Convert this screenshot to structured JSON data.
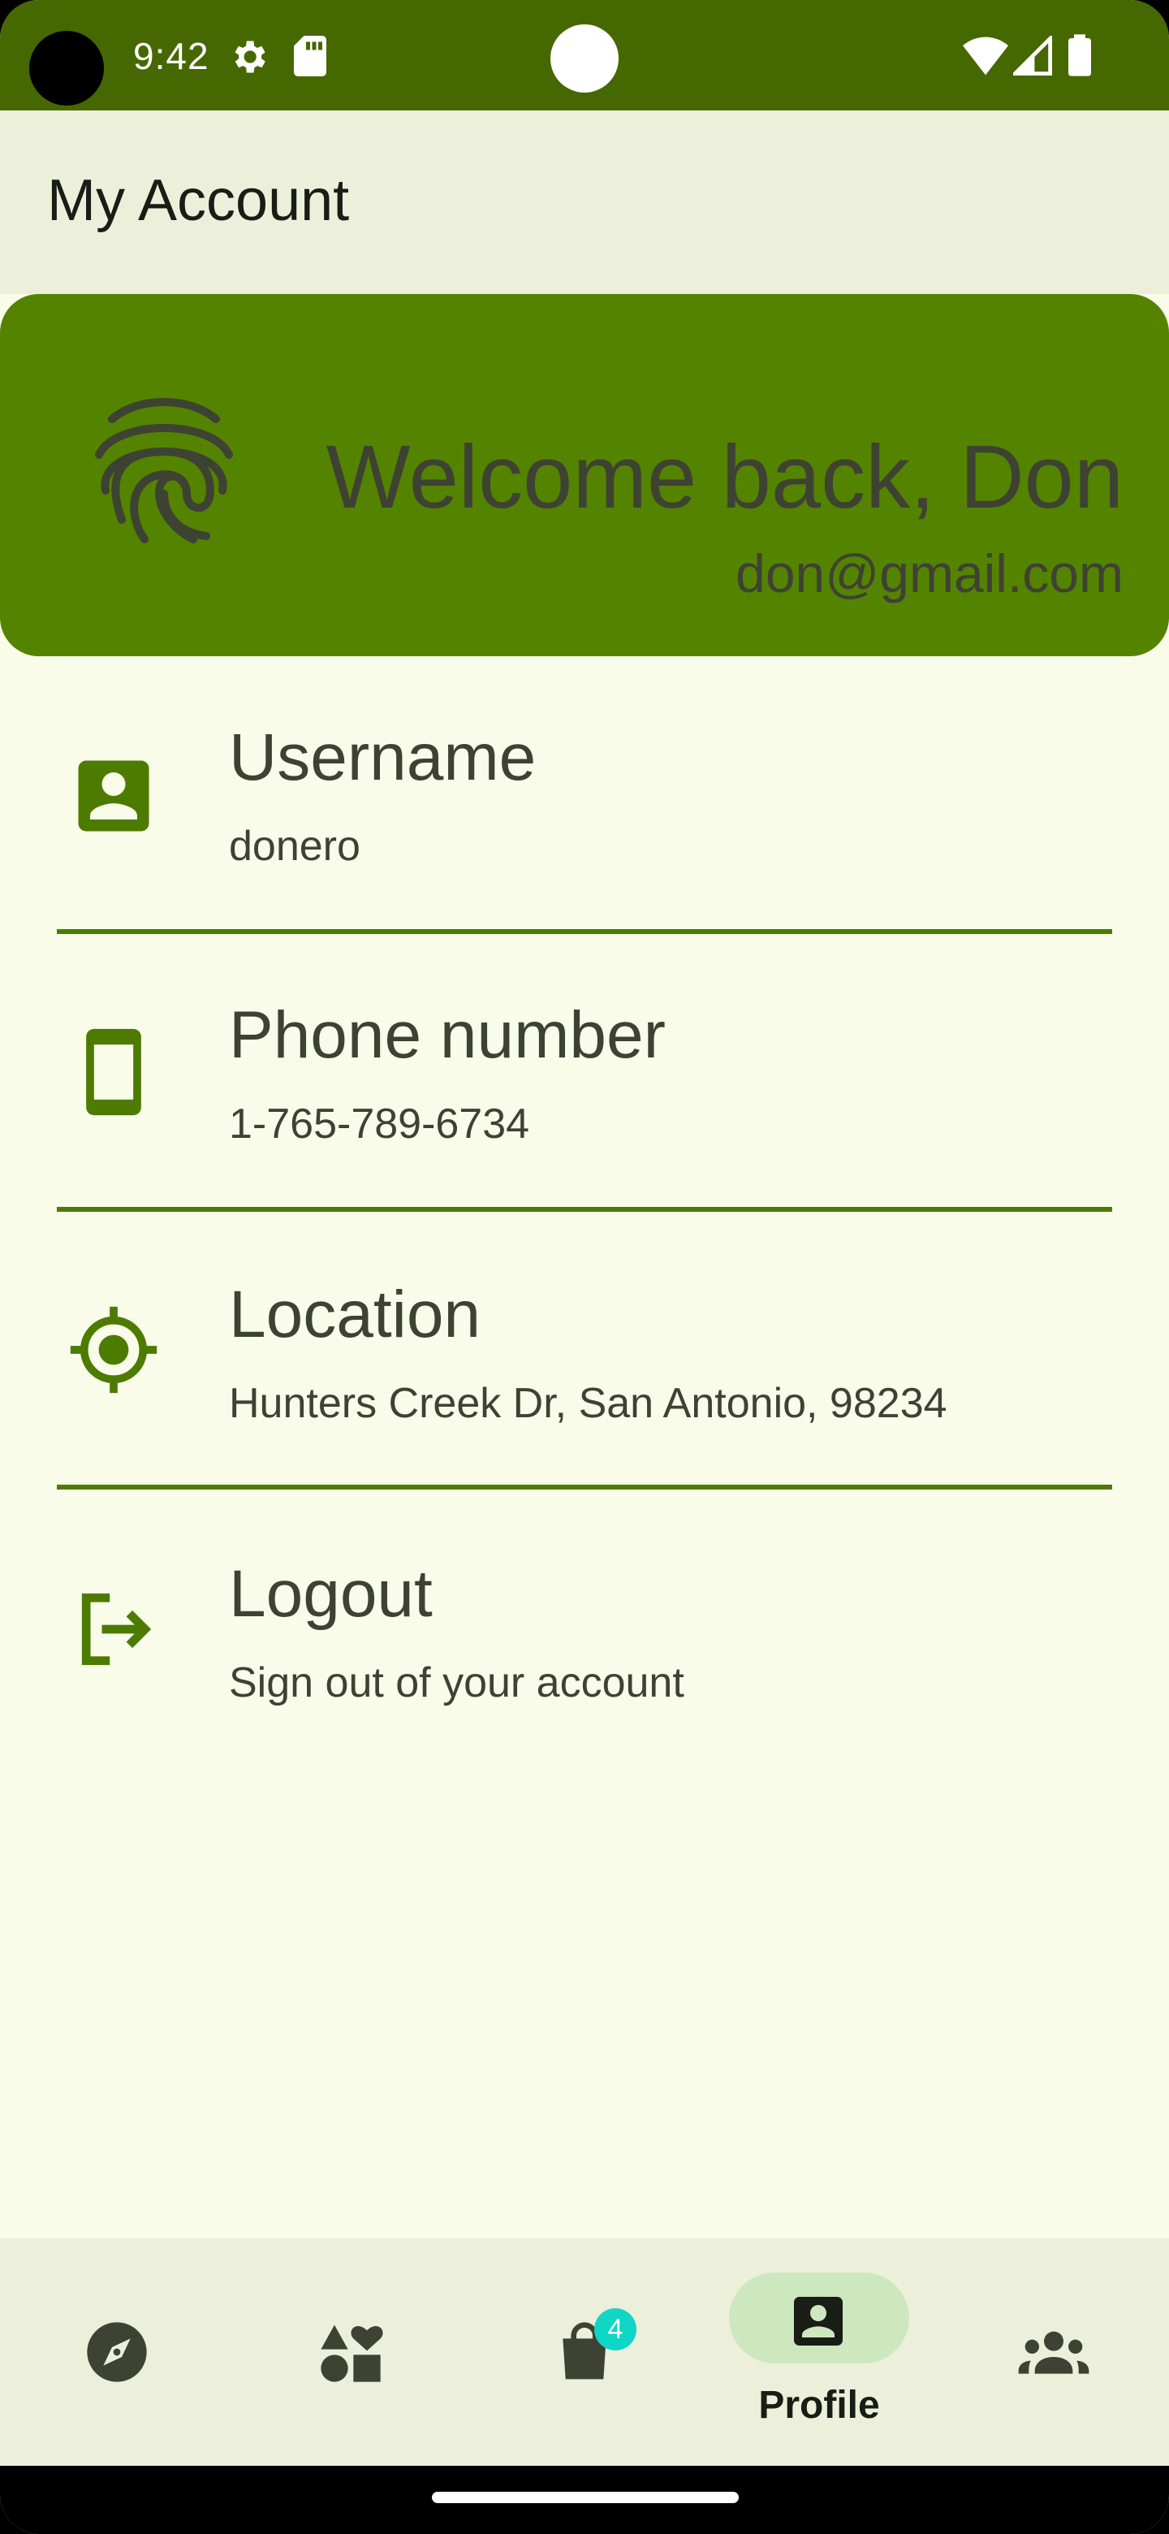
{
  "status_bar": {
    "time": "9:42",
    "icons": [
      "gear-icon",
      "sd-card-icon",
      "wifi-icon",
      "signal-icon",
      "battery-icon"
    ]
  },
  "app_bar": {
    "title": "My Account"
  },
  "header": {
    "welcome": "Welcome back, Don",
    "email": "don@gmail.com",
    "icon": "fingerprint-icon"
  },
  "items": [
    {
      "title": "Username",
      "subtitle": "donero",
      "icon": "account-box-icon"
    },
    {
      "title": "Phone number",
      "subtitle": "1-765-789-6734",
      "icon": "phone-icon"
    },
    {
      "title": "Location",
      "subtitle": "Hunters Creek Dr, San Antonio, 98234",
      "icon": "location-target-icon"
    },
    {
      "title": "Logout",
      "subtitle": "Sign out of your account",
      "icon": "logout-icon"
    }
  ],
  "bottom_nav": {
    "items": [
      {
        "icon": "explore-icon",
        "label": ""
      },
      {
        "icon": "category-icon",
        "label": ""
      },
      {
        "icon": "shopping-bag-icon",
        "label": "",
        "badge": "4"
      },
      {
        "icon": "profile-icon",
        "label": "Profile",
        "selected": true
      },
      {
        "icon": "group-icon",
        "label": ""
      }
    ]
  },
  "colors": {
    "primary": "#456800",
    "header_card": "#548300",
    "background": "#f9fce9",
    "surface": "#ecf0da",
    "text": "#3e4232",
    "badge": "#10d6c6",
    "selected_pill": "#cde8bf"
  }
}
